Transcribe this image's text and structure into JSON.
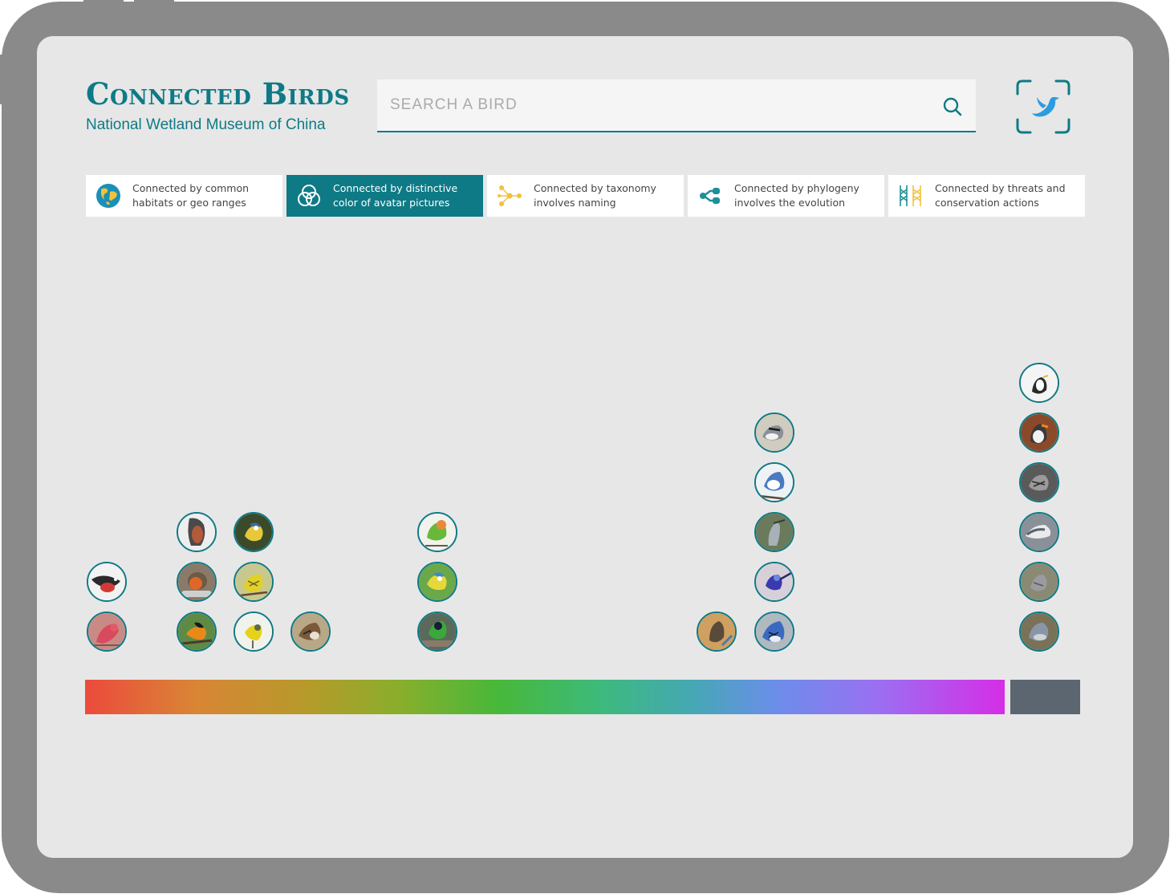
{
  "app": {
    "title": "Connected Birds",
    "subtitle": "National Wetland Museum of China"
  },
  "search": {
    "placeholder": "SEARCH A BIRD",
    "value": "",
    "icon": "search-icon"
  },
  "scan": {
    "icon": "bird-scan-icon"
  },
  "colors": {
    "accent": "#0e7a86",
    "screen_bg": "#e7e7e7",
    "frame": "#8a8a8a",
    "gray_swatch": "#5b6670",
    "spectrum": [
      "#ec4a3c",
      "#d98535",
      "#b69a2a",
      "#8aae2c",
      "#47b83a",
      "#3dba7c",
      "#45a8b4",
      "#6b8eea",
      "#9a70f2",
      "#d52ee6"
    ]
  },
  "tabs": [
    {
      "label": "Connected by common\nhabitats or geo ranges",
      "icon": "globe-icon",
      "active": false
    },
    {
      "label": "Connected by distinctive\ncolor of avatar pictures",
      "icon": "color-circles-icon",
      "active": true
    },
    {
      "label": "Connected by taxonomy\ninvolves naming",
      "icon": "taxonomy-network-icon",
      "active": false
    },
    {
      "label": "Connected by phylogeny\ninvolves the evolution",
      "icon": "phylogeny-tree-icon",
      "active": false
    },
    {
      "label": "Connected by threats and\nconservation actions",
      "icon": "threats-fence-icon",
      "active": false
    }
  ],
  "color_columns": [
    {
      "hue": "red",
      "birds": [
        "pink-finch",
        "black-and-white-bird-red-belly"
      ]
    },
    {
      "hue": "orange",
      "birds": [
        "orange-oriole",
        "european-robin",
        "chestnut-breasted-pigeon"
      ]
    },
    {
      "hue": "yellow",
      "birds": [
        "yellow-warbler",
        "yellow-streaked-bird",
        "blue-tit"
      ]
    },
    {
      "hue": "brown",
      "birds": [
        "sparrow"
      ]
    },
    {
      "hue": "green",
      "birds": [
        "green-tanager",
        "blue-green-tit",
        "green-parrot"
      ]
    },
    {
      "hue": "blue",
      "birds": [
        "brown-bird-blue-background"
      ]
    },
    {
      "hue": "blue-violet",
      "birds": [
        "blue-jay",
        "superb-fairywren",
        "gray-heron",
        "white-throated-jay",
        "gray-shrike"
      ]
    },
    {
      "hue": "gray",
      "birds": [
        "gray-bird-1",
        "gray-bird-2",
        "gray-white-gull",
        "streaked-gray-bird",
        "gray-brown-bird-orange-bill",
        "black-white-bird"
      ]
    }
  ]
}
